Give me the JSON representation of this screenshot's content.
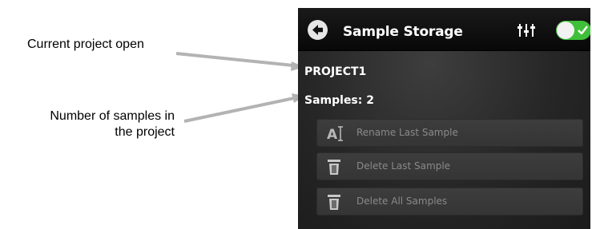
{
  "callouts": {
    "current_project": "Current project open",
    "samples_line1": "Number of samples in",
    "samples_line2": "the project"
  },
  "header": {
    "title": "Sample Storage",
    "back_icon": "arrow-left-circle-icon",
    "settings_icon": "sliders-icon",
    "toggle_state": "on"
  },
  "project": {
    "name": "PROJECT1",
    "samples_text": "Samples: 2"
  },
  "actions": [
    {
      "label": "Rename Last Sample",
      "icon": "rename-icon"
    },
    {
      "label": "Delete Last Sample",
      "icon": "trash-icon"
    },
    {
      "label": "Delete All Samples",
      "icon": "trash-icon"
    }
  ],
  "colors": {
    "toggle_on": "#3fbf3a",
    "background": "#262626",
    "button_text": "#8a8a8a"
  }
}
